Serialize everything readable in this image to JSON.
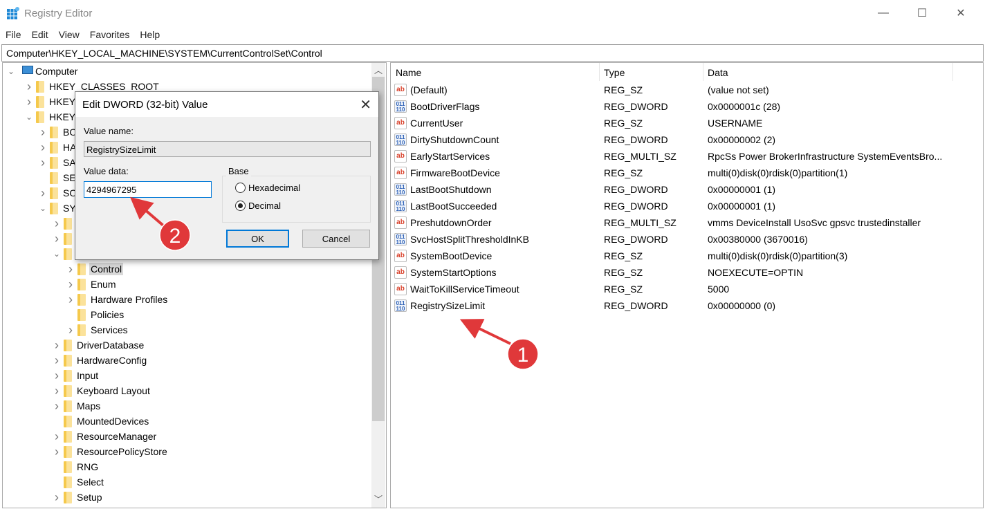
{
  "window": {
    "title": "Registry Editor",
    "minimize": "—",
    "maximize": "☐",
    "close": "✕"
  },
  "menu": [
    "File",
    "Edit",
    "View",
    "Favorites",
    "Help"
  ],
  "address": "Computer\\HKEY_LOCAL_MACHINE\\SYSTEM\\CurrentControlSet\\Control",
  "tree": [
    {
      "label": "Computer",
      "level": 0,
      "exp": "open",
      "icon": "computer"
    },
    {
      "label": "HKEY_CLASSES_ROOT",
      "level": 1,
      "exp": "closed"
    },
    {
      "label": "HKEY_",
      "level": 1,
      "exp": "closed"
    },
    {
      "label": "HKEY_",
      "level": 1,
      "exp": "open"
    },
    {
      "label": "BO",
      "level": 2,
      "exp": "closed"
    },
    {
      "label": "HA",
      "level": 2,
      "exp": "closed"
    },
    {
      "label": "SA",
      "level": 2,
      "exp": "closed"
    },
    {
      "label": "SE",
      "level": 2,
      "exp": "none"
    },
    {
      "label": "SO",
      "level": 2,
      "exp": "closed"
    },
    {
      "label": "SY",
      "level": 2,
      "exp": "open"
    },
    {
      "label": "",
      "level": 3,
      "exp": "closed"
    },
    {
      "label": "",
      "level": 3,
      "exp": "closed"
    },
    {
      "label": "",
      "level": 3,
      "exp": "open"
    },
    {
      "label": "Control",
      "level": 4,
      "exp": "closed",
      "selected": true
    },
    {
      "label": "Enum",
      "level": 4,
      "exp": "closed"
    },
    {
      "label": "Hardware Profiles",
      "level": 4,
      "exp": "closed"
    },
    {
      "label": "Policies",
      "level": 4,
      "exp": "none"
    },
    {
      "label": "Services",
      "level": 4,
      "exp": "closed"
    },
    {
      "label": "DriverDatabase",
      "level": 3,
      "exp": "closed"
    },
    {
      "label": "HardwareConfig",
      "level": 3,
      "exp": "closed"
    },
    {
      "label": "Input",
      "level": 3,
      "exp": "closed"
    },
    {
      "label": "Keyboard Layout",
      "level": 3,
      "exp": "closed"
    },
    {
      "label": "Maps",
      "level": 3,
      "exp": "closed"
    },
    {
      "label": "MountedDevices",
      "level": 3,
      "exp": "none"
    },
    {
      "label": "ResourceManager",
      "level": 3,
      "exp": "closed"
    },
    {
      "label": "ResourcePolicyStore",
      "level": 3,
      "exp": "closed"
    },
    {
      "label": "RNG",
      "level": 3,
      "exp": "none"
    },
    {
      "label": "Select",
      "level": 3,
      "exp": "none"
    },
    {
      "label": "Setup",
      "level": 3,
      "exp": "closed"
    }
  ],
  "list": {
    "headers": {
      "name": "Name",
      "type": "Type",
      "data": "Data"
    },
    "rows": [
      {
        "name": "(Default)",
        "type": "REG_SZ",
        "data": "(value not set)",
        "icon": "sz"
      },
      {
        "name": "BootDriverFlags",
        "type": "REG_DWORD",
        "data": "0x0000001c (28)",
        "icon": "bin"
      },
      {
        "name": "CurrentUser",
        "type": "REG_SZ",
        "data": "USERNAME",
        "icon": "sz"
      },
      {
        "name": "DirtyShutdownCount",
        "type": "REG_DWORD",
        "data": "0x00000002 (2)",
        "icon": "bin"
      },
      {
        "name": "EarlyStartServices",
        "type": "REG_MULTI_SZ",
        "data": "RpcSs Power BrokerInfrastructure SystemEventsBro...",
        "icon": "sz"
      },
      {
        "name": "FirmwareBootDevice",
        "type": "REG_SZ",
        "data": "multi(0)disk(0)rdisk(0)partition(1)",
        "icon": "sz"
      },
      {
        "name": "LastBootShutdown",
        "type": "REG_DWORD",
        "data": "0x00000001 (1)",
        "icon": "bin"
      },
      {
        "name": "LastBootSucceeded",
        "type": "REG_DWORD",
        "data": "0x00000001 (1)",
        "icon": "bin"
      },
      {
        "name": "PreshutdownOrder",
        "type": "REG_MULTI_SZ",
        "data": "vmms DeviceInstall UsoSvc gpsvc trustedinstaller",
        "icon": "sz"
      },
      {
        "name": "SvcHostSplitThresholdInKB",
        "type": "REG_DWORD",
        "data": "0x00380000 (3670016)",
        "icon": "bin"
      },
      {
        "name": "SystemBootDevice",
        "type": "REG_SZ",
        "data": "multi(0)disk(0)rdisk(0)partition(3)",
        "icon": "sz"
      },
      {
        "name": "SystemStartOptions",
        "type": "REG_SZ",
        "data": " NOEXECUTE=OPTIN",
        "icon": "sz"
      },
      {
        "name": "WaitToKillServiceTimeout",
        "type": "REG_SZ",
        "data": "5000",
        "icon": "sz"
      },
      {
        "name": "RegistrySizeLimit",
        "type": "REG_DWORD",
        "data": "0x00000000 (0)",
        "icon": "bin"
      }
    ]
  },
  "dialog": {
    "title": "Edit DWORD (32-bit) Value",
    "close": "✕",
    "value_name_label": "Value name:",
    "value_name": "RegistrySizeLimit",
    "value_data_label": "Value data:",
    "value_data": "4294967295",
    "base_label": "Base",
    "hex_label": "Hexadecimal",
    "dec_label": "Decimal",
    "selected_base": "Decimal",
    "ok": "OK",
    "cancel": "Cancel"
  },
  "annotations": {
    "step1": "1",
    "step2": "2",
    "color": "#e0383a"
  }
}
